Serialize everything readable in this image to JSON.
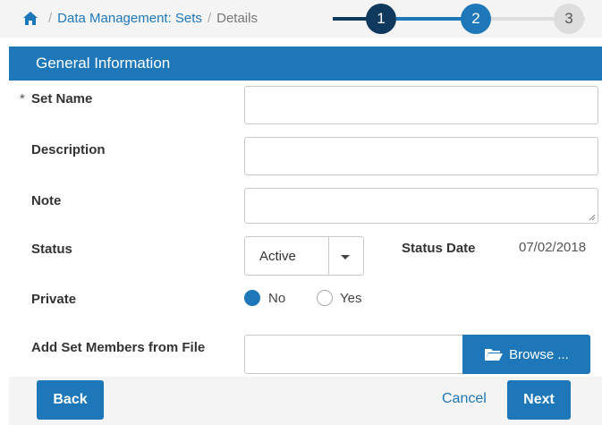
{
  "breadcrumb": {
    "home_icon": "home-icon",
    "link": "Data Management: Sets",
    "separator": "/",
    "current": "Details"
  },
  "stepper": {
    "steps": [
      "1",
      "2",
      "3"
    ],
    "current_step": 1,
    "colors": {
      "done": "#0f3a5e",
      "active": "#1d77b8",
      "pending": "#dddddd"
    }
  },
  "section": {
    "title": "General Information"
  },
  "form": {
    "required_marker": "*",
    "set_name": {
      "label": "Set Name",
      "value": ""
    },
    "description": {
      "label": "Description",
      "value": ""
    },
    "note": {
      "label": "Note",
      "value": ""
    },
    "status": {
      "label": "Status",
      "value": "Active"
    },
    "status_date": {
      "label": "Status Date",
      "value": "07/02/2018"
    },
    "private": {
      "label": "Private",
      "options": [
        "No",
        "Yes"
      ],
      "selected": "No"
    },
    "add_members": {
      "label": "Add Set Members from File",
      "browse_label": "Browse ...",
      "browse_icon": "folder-open-icon"
    }
  },
  "footer": {
    "back": "Back",
    "cancel": "Cancel",
    "next": "Next"
  },
  "colors": {
    "accent": "#1d77b8",
    "dark": "#0f3a5e",
    "background_bar": "#f4f4f4"
  }
}
